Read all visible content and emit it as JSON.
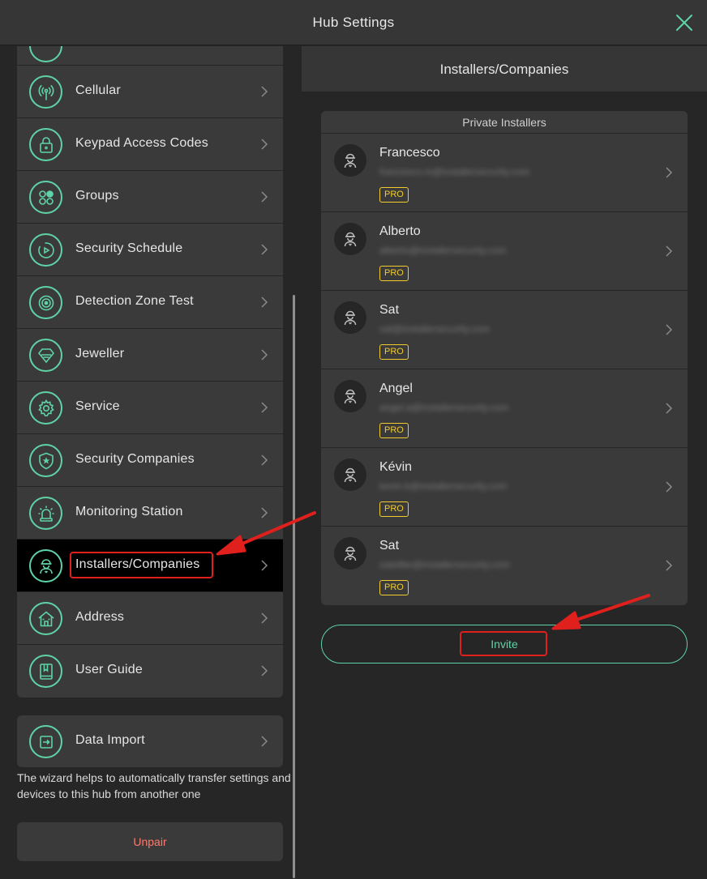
{
  "window": {
    "title": "Hub Settings",
    "close_icon": "close-icon"
  },
  "sidebar": {
    "items": [
      {
        "label": "Cellular",
        "icon": "cellular-icon"
      },
      {
        "label": "Keypad Access Codes",
        "icon": "lock-icon"
      },
      {
        "label": "Groups",
        "icon": "groups-icon"
      },
      {
        "label": "Security Schedule",
        "icon": "schedule-icon"
      },
      {
        "label": "Detection Zone Test",
        "icon": "detection-icon"
      },
      {
        "label": "Jeweller",
        "icon": "jeweller-icon"
      },
      {
        "label": "Service",
        "icon": "gear-icon"
      },
      {
        "label": "Security Companies",
        "icon": "shield-icon"
      },
      {
        "label": "Monitoring Station",
        "icon": "siren-icon"
      },
      {
        "label": "Installers/Companies",
        "icon": "installer-icon",
        "active": true
      },
      {
        "label": "Address",
        "icon": "home-icon"
      },
      {
        "label": "User Guide",
        "icon": "book-icon"
      }
    ],
    "data_import": {
      "label": "Data Import",
      "icon": "import-icon"
    },
    "help_text": "The wizard helps to automatically transfer settings and devices to this hub from another one",
    "unpair_label": "Unpair"
  },
  "detail": {
    "title": "Installers/Companies",
    "section_label": "Private Installers",
    "installers": [
      {
        "name": "Francesco",
        "email": "francesco.m@installersecurity.com",
        "badge": "PRO"
      },
      {
        "name": "Alberto",
        "email": "alberto@installersecurity.com",
        "badge": "PRO"
      },
      {
        "name": "Sat",
        "email": "sat@installersecurity.com",
        "badge": "PRO"
      },
      {
        "name": "Angel",
        "email": "angel.a@installersecurity.com",
        "badge": "PRO"
      },
      {
        "name": "Kévin",
        "email": "kevin.k@installersecurity.com",
        "badge": "PRO"
      },
      {
        "name": "Sat",
        "email": "satellite@installersecurity.com",
        "badge": "PRO"
      }
    ],
    "invite_label": "Invite"
  },
  "colors": {
    "accent": "#5fd3a8",
    "badge": "#f2cc2f",
    "danger": "#ff7a6b",
    "annotation": "#e0201c"
  }
}
